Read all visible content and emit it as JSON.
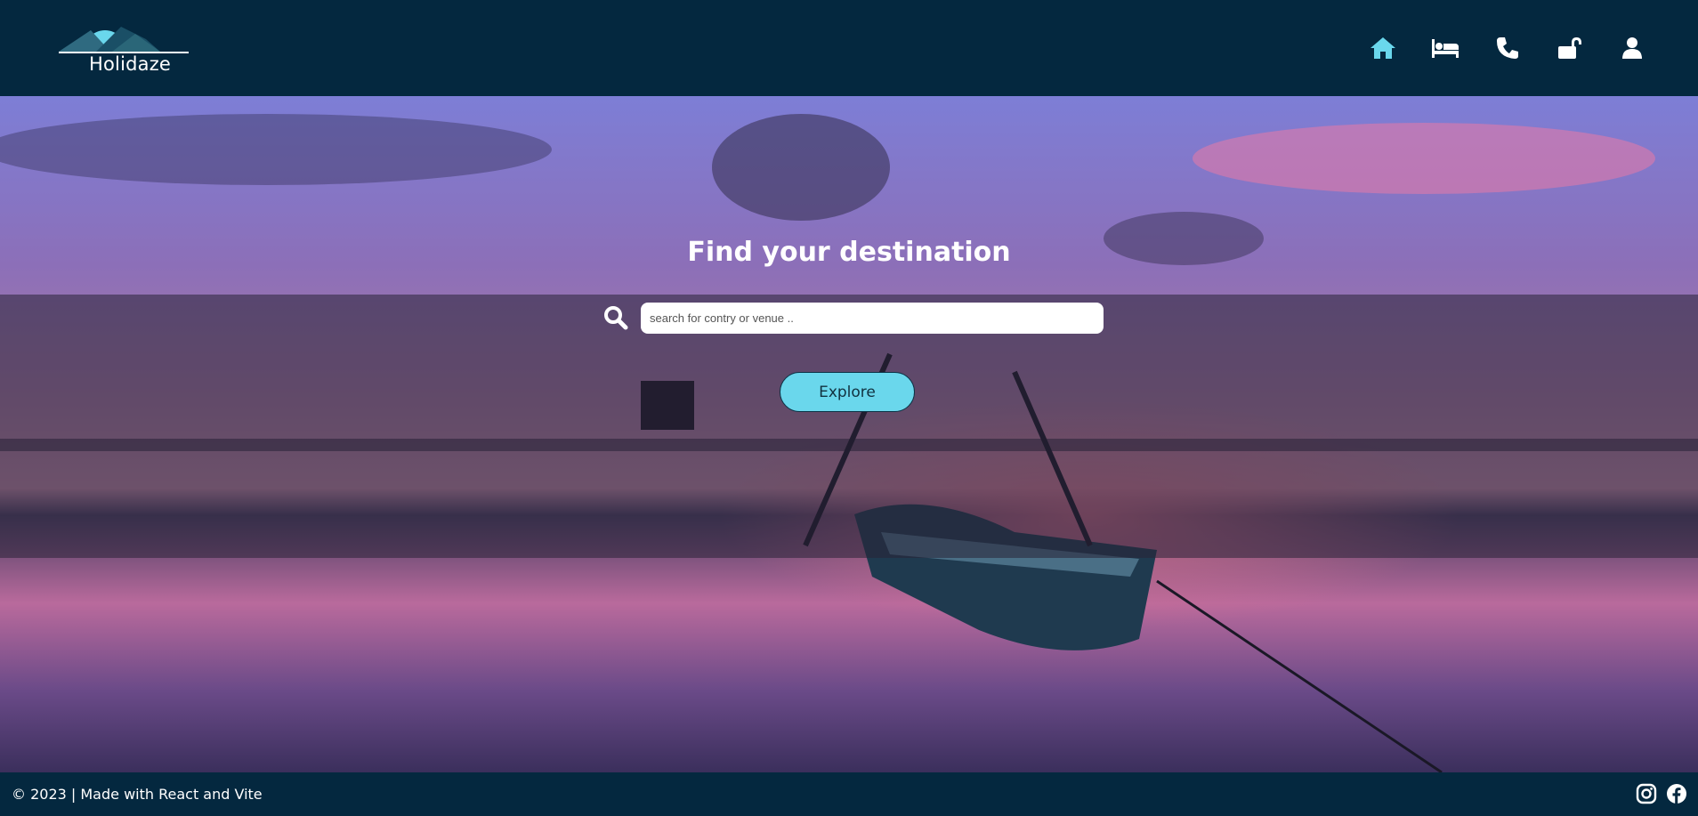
{
  "header": {
    "logo_text": "Holidaze",
    "nav": [
      {
        "icon": "home-icon",
        "active": true
      },
      {
        "icon": "bed-icon"
      },
      {
        "icon": "phone-icon"
      },
      {
        "icon": "unlock-icon"
      },
      {
        "icon": "user-icon"
      }
    ]
  },
  "hero": {
    "title": "Find your destination",
    "search_placeholder": "search for contry or venue ..",
    "search_value": "",
    "explore_label": "Explore"
  },
  "footer": {
    "text": "© 2023 | Made with React and Vite",
    "social": [
      "instagram-icon",
      "facebook-icon"
    ]
  },
  "colors": {
    "header_bg": "#04283f",
    "accent": "#6ad7ec",
    "text": "#ffffff"
  }
}
